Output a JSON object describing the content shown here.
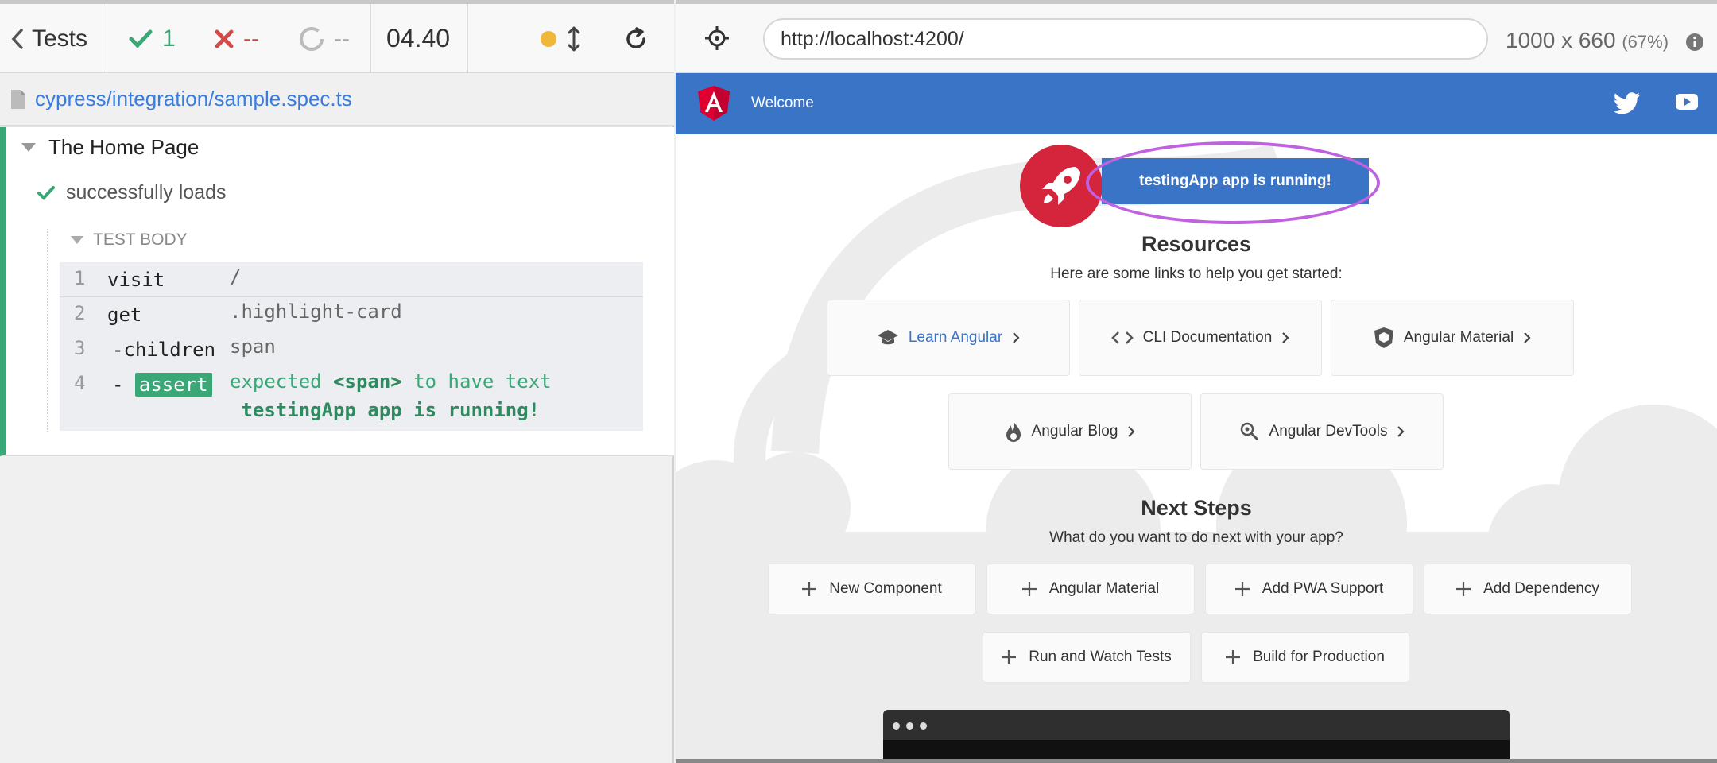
{
  "runner": {
    "tests_label": "Tests",
    "passed": "1",
    "failed": "--",
    "pending": "--",
    "duration": "04.40",
    "status_color": "#f0b83a",
    "spec_path": "cypress/integration/sample.spec.ts"
  },
  "suite": {
    "title": "The Home Page",
    "test_title": "successfully loads",
    "test_body_label": "TEST BODY",
    "commands": [
      {
        "num": "1",
        "name": "visit",
        "arg": "/"
      },
      {
        "num": "2",
        "name": "get",
        "arg": ".highlight-card"
      },
      {
        "num": "3",
        "name": "-children",
        "arg": "span"
      },
      {
        "num": "4",
        "name": "-",
        "tag": "assert",
        "arg_pre": "expected",
        "arg_el": "<span>",
        "arg_mid": "to have text",
        "arg_text": "testingApp app is running!"
      }
    ]
  },
  "aut": {
    "url": "http://localhost:4200/",
    "viewport": "1000 x 660",
    "scale": "(67%)"
  },
  "app": {
    "toolbar_title": "Welcome",
    "running_text": "testingApp app is running!",
    "resources_title": "Resources",
    "resources_sub": "Here are some links to help you get started:",
    "resources": [
      {
        "label": "Learn Angular",
        "icon": "graduation-cap-icon"
      },
      {
        "label": "CLI Documentation",
        "icon": "code-icon"
      },
      {
        "label": "Angular Material",
        "icon": "material-shield-icon"
      },
      {
        "label": "Angular Blog",
        "icon": "flame-icon"
      },
      {
        "label": "Angular DevTools",
        "icon": "magnifier-icon"
      }
    ],
    "next_title": "Next Steps",
    "next_sub": "What do you want to do next with your app?",
    "steps": [
      {
        "label": "New Component"
      },
      {
        "label": "Angular Material"
      },
      {
        "label": "Add PWA Support"
      },
      {
        "label": "Add Dependency"
      },
      {
        "label": "Run and Watch Tests"
      },
      {
        "label": "Build for Production"
      }
    ],
    "colors": {
      "toolbar": "#3a74c7",
      "rocket": "#d4253c",
      "highlight": "#c062e0",
      "pass": "#3aa776",
      "fail": "#d24b4b"
    }
  }
}
